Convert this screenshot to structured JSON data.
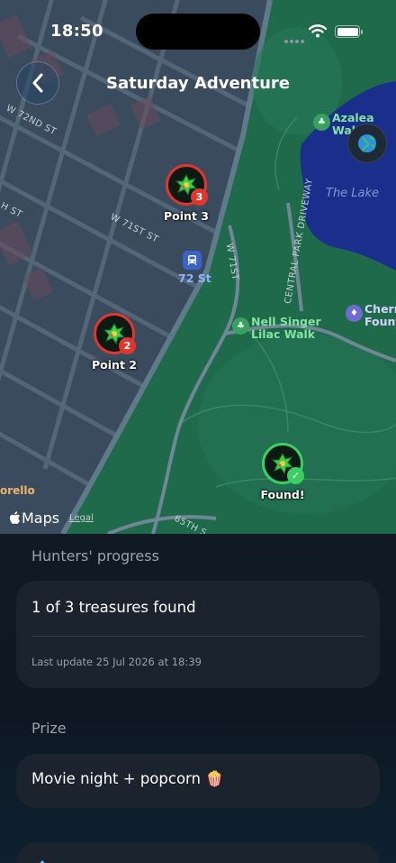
{
  "status_bar": {
    "time": "18:50"
  },
  "nav": {
    "title": "Saturday Adventure"
  },
  "map": {
    "markers": [
      {
        "label": "Point 3",
        "badge": "3",
        "state": "pending"
      },
      {
        "label": "Point 2",
        "badge": "2",
        "state": "pending"
      },
      {
        "label": "Found!",
        "badge": "✓",
        "state": "found"
      }
    ],
    "pois": {
      "azalea": [
        "Azalea",
        "Wal"
      ],
      "nell_singer": [
        "Nell Singer",
        "Lilac Walk"
      ],
      "cherry": [
        "Cherr",
        "Founta"
      ]
    },
    "lake": "The Lake",
    "streets": {
      "w72": "W 72ND ST",
      "w71": "W 71ST ST",
      "w71_short": "W 71ST",
      "central_park_dr": "CENTRAL PARK DRIVEWAY",
      "w72_vert": "W 72ND ST",
      "h_st": "H ST",
      "w65": "65TH S"
    },
    "metro_label": "72 St",
    "place_orange": "orello",
    "maps_logo": "Maps",
    "legal": "Legal"
  },
  "progress": {
    "section_title": "Hunters' progress",
    "summary": "1 of 3 treasures found",
    "last_update": "Last update 25 Jul 2026 at 18:39"
  },
  "prize": {
    "section_title": "Prize",
    "value": "Movie night + popcorn 🍿"
  },
  "colors": {
    "pending_ring": "#e0362f",
    "found_ring": "#3ad061",
    "park": "#1f6a4a",
    "lake": "#1a2f8c",
    "city": "#3a4c5e",
    "sheet_bg": "#111a24",
    "card_bg": "#1a232e"
  },
  "icons": [
    "back-chevron-icon",
    "globe-icon",
    "treasure-icon",
    "check-icon",
    "metro-icon",
    "wifi-icon",
    "battery-icon",
    "apple-logo-icon"
  ]
}
